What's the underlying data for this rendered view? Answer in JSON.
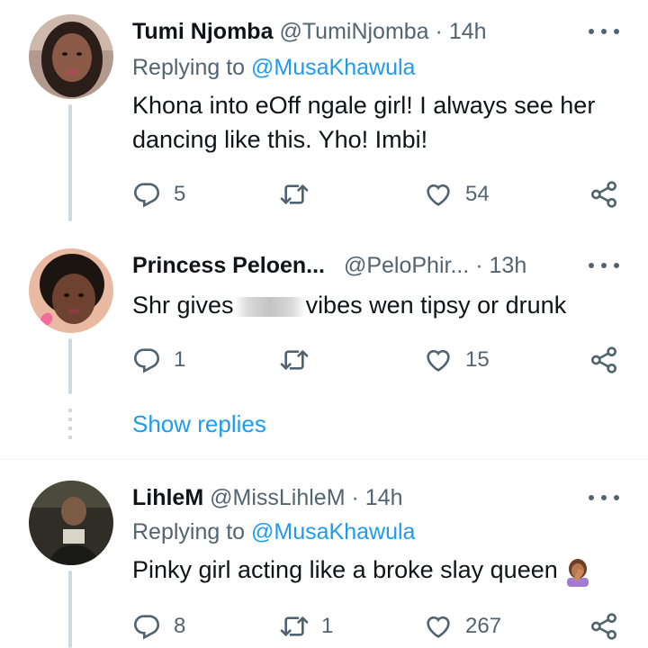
{
  "tweets": [
    {
      "name": "Tumi Njomba",
      "handle": "@TumiNjomba",
      "sep": "·",
      "time": "14h",
      "replying_prefix": "Replying to ",
      "replying_to": "@MusaKhawula",
      "text_line1": "Khona into eOff ngale girl! I always see her",
      "text_line2": "dancing like this. Yho! Imbi!",
      "replies": "5",
      "retweets": "",
      "likes": "54"
    },
    {
      "name": "Princess Peloen...",
      "handle": "@PeloPhir...",
      "sep": "·",
      "time": "13h",
      "text_before": "Shr gives",
      "text_after": "vibes wen tipsy or drunk",
      "replies": "1",
      "retweets": "",
      "likes": "15",
      "show_replies": "Show replies"
    },
    {
      "name": "LihleM",
      "handle": "@MissLihleM",
      "sep": "·",
      "time": "14h",
      "replying_prefix": "Replying to ",
      "replying_to": "@MusaKhawula",
      "text": "Pinky girl acting like a broke slay queen",
      "replies": "8",
      "retweets": "1",
      "likes": "267"
    }
  ],
  "icons": [
    "reply-icon",
    "retweet-icon",
    "like-icon",
    "share-icon",
    "more-icon"
  ],
  "colors": {
    "link": "#1d9bf0",
    "secondary": "#536471",
    "text": "#0f1419",
    "thread": "#cfd9de"
  }
}
